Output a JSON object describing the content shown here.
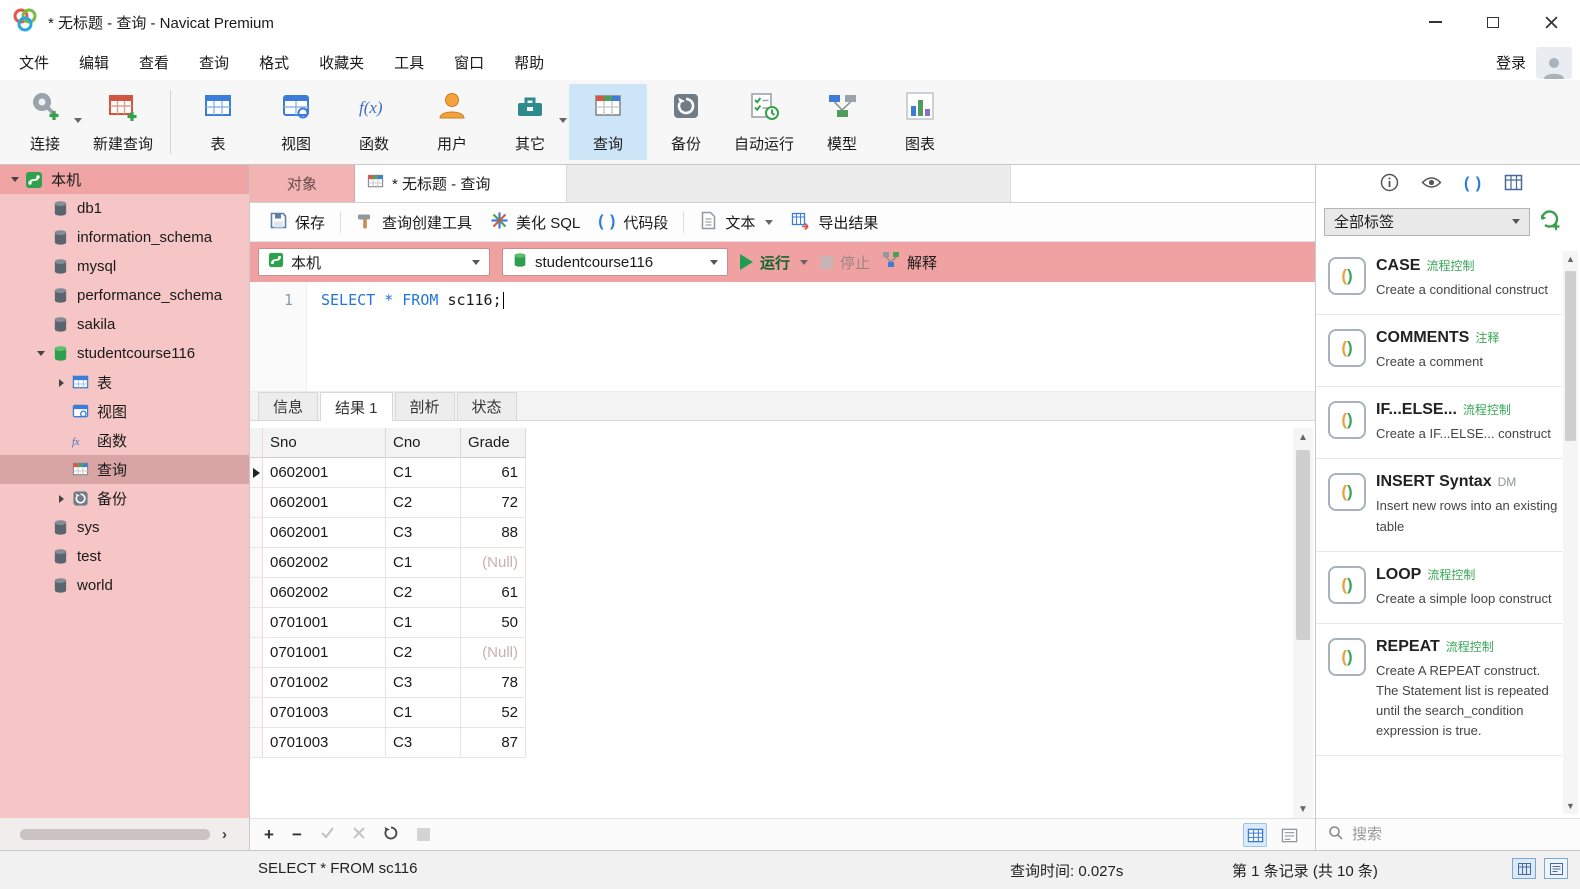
{
  "titlebar": {
    "title": "* 无标题 - 查询 - Navicat Premium"
  },
  "menubar": {
    "items": [
      "文件",
      "编辑",
      "查看",
      "查询",
      "格式",
      "收藏夹",
      "工具",
      "窗口",
      "帮助"
    ],
    "login": "登录"
  },
  "toolbar": {
    "items": [
      {
        "label": "连接",
        "icon": "connection-icon",
        "dropdown": true
      },
      {
        "label": "新建查询",
        "icon": "new-query-icon"
      },
      {
        "label": "表",
        "icon": "table-icon"
      },
      {
        "label": "视图",
        "icon": "view-icon"
      },
      {
        "label": "函数",
        "icon": "function-icon"
      },
      {
        "label": "用户",
        "icon": "user-icon"
      },
      {
        "label": "其它",
        "icon": "others-icon",
        "dropdown": true
      },
      {
        "label": "查询",
        "icon": "query-icon",
        "active": true
      },
      {
        "label": "备份",
        "icon": "backup-icon"
      },
      {
        "label": "自动运行",
        "icon": "automation-icon"
      },
      {
        "label": "模型",
        "icon": "model-icon"
      },
      {
        "label": "图表",
        "icon": "chart-icon"
      }
    ]
  },
  "sidebar": {
    "items": [
      {
        "label": "本机",
        "type": "connection",
        "expanded": true
      },
      {
        "label": "db1",
        "type": "database"
      },
      {
        "label": "information_schema",
        "type": "database"
      },
      {
        "label": "mysql",
        "type": "database"
      },
      {
        "label": "performance_schema",
        "type": "database"
      },
      {
        "label": "sakila",
        "type": "database"
      },
      {
        "label": "studentcourse116",
        "type": "database-open",
        "expanded": true
      },
      {
        "label": "表",
        "type": "tables",
        "collapsed": true
      },
      {
        "label": "视图",
        "type": "views"
      },
      {
        "label": "函数",
        "type": "functions"
      },
      {
        "label": "查询",
        "type": "queries",
        "selected": true
      },
      {
        "label": "备份",
        "type": "backups",
        "collapsed": true
      },
      {
        "label": "sys",
        "type": "database"
      },
      {
        "label": "test",
        "type": "database"
      },
      {
        "label": "world",
        "type": "database"
      }
    ]
  },
  "tabs": {
    "objects": "对象",
    "query": "* 无标题 - 查询"
  },
  "query_toolbar": {
    "save": "保存",
    "builder": "查询创建工具",
    "beautify": "美化 SQL",
    "snippet": "代码段",
    "text": "文本",
    "export": "导出结果"
  },
  "exec_bar": {
    "connection": "本机",
    "database": "studentcourse116",
    "run": "运行",
    "stop": "停止",
    "explain": "解释"
  },
  "editor": {
    "line_number": "1",
    "sql": {
      "kw1": "SELECT",
      "star": "*",
      "kw2": "FROM",
      "rest": "sc116;"
    }
  },
  "result_tabs": [
    "信息",
    "结果 1",
    "剖析",
    "状态"
  ],
  "grid": {
    "columns": [
      "Sno",
      "Cno",
      "Grade"
    ],
    "rows": [
      [
        "0602001",
        "C1",
        "61"
      ],
      [
        "0602001",
        "C2",
        "72"
      ],
      [
        "0602001",
        "C3",
        "88"
      ],
      [
        "0602002",
        "C1",
        "(Null)"
      ],
      [
        "0602002",
        "C2",
        "61"
      ],
      [
        "0701001",
        "C1",
        "50"
      ],
      [
        "0701001",
        "C2",
        "(Null)"
      ],
      [
        "0701002",
        "C3",
        "78"
      ],
      [
        "0701003",
        "C1",
        "52"
      ],
      [
        "0701003",
        "C3",
        "87"
      ]
    ]
  },
  "snippets": {
    "filter": "全部标签",
    "items": [
      {
        "name": "CASE",
        "tag": "流程控制",
        "desc": "Create a conditional construct"
      },
      {
        "name": "COMMENTS",
        "tag": "注释",
        "desc": "Create a comment"
      },
      {
        "name": "IF...ELSE...",
        "tag": "流程控制",
        "desc": "Create a IF...ELSE... construct"
      },
      {
        "name": "INSERT Syntax",
        "tag": "DM",
        "desc": "Insert new rows into an existing table"
      },
      {
        "name": "LOOP",
        "tag": "流程控制",
        "desc": "Create a simple loop construct"
      },
      {
        "name": "REPEAT",
        "tag": "流程控制",
        "desc": "Create A REPEAT construct. The Statement list is repeated until the search_condition expression is true."
      }
    ],
    "search_placeholder": "搜索"
  },
  "statusbar": {
    "left": "SELECT * FROM sc116",
    "time": "查询时间: 0.027s",
    "records": "第 1 条记录 (共 10 条)"
  },
  "colors": {
    "sidebar_pink": "#f6c6c6",
    "exec_bar_pink": "#f0a2a2",
    "selected_row_pink": "#d8a4a4",
    "connection_row_pink": "#f0a4a4",
    "active_toolbar_blue": "#cde6f7",
    "run_green": "#1d9e53",
    "keyword_blue": "#2477d4",
    "snippet_green": "#3aa657",
    "snippet_orange": "#e8a13c"
  }
}
